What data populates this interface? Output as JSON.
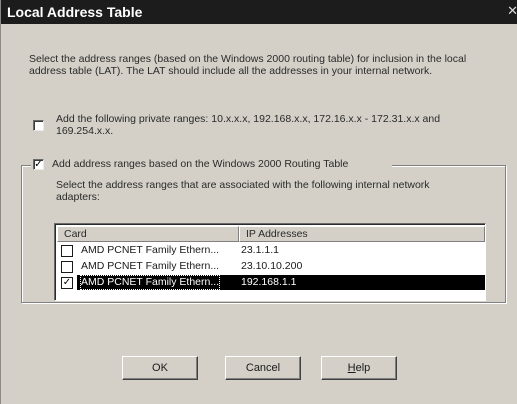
{
  "window": {
    "title": "Local Address Table",
    "close_glyph": "✕"
  },
  "intro": {
    "text": "Select the address ranges (based on the Windows 2000 routing table) for inclusion in the local address table (LAT). The LAT should include all the addresses in your internal network."
  },
  "private_ranges": {
    "checked": false,
    "label": "Add the following private ranges: 10.x.x.x, 192.168.x.x, 172.16.x.x - 172.31.x.x and 169.254.x.x."
  },
  "routing_group": {
    "checked": true,
    "check_glyph": "✓",
    "label": "Add address ranges based on the Windows 2000 Routing Table",
    "instructions": "Select the address ranges that are associated with the following internal network adapters:"
  },
  "adapter_list": {
    "columns": [
      "Card",
      "IP Addresses"
    ],
    "rows": [
      {
        "checked": false,
        "check_glyph": "",
        "card": "AMD PCNET Family Ethern...",
        "ip": "23.1.1.1",
        "selected": false
      },
      {
        "checked": false,
        "check_glyph": "",
        "card": "AMD PCNET Family Ethern...",
        "ip": "23.10.10.200",
        "selected": false
      },
      {
        "checked": true,
        "check_glyph": "✓",
        "card": "AMD PCNET Family Ethern...",
        "ip": "192.168.1.1",
        "selected": true
      }
    ]
  },
  "buttons": {
    "ok": "OK",
    "cancel": "Cancel",
    "help_mnemonic": "H",
    "help_rest": "elp"
  },
  "colors": {
    "titlebar": "#1c1c1c",
    "dialog_face": "#d4d0c8",
    "selection": "#000000"
  },
  "icons": {
    "close": "close-icon",
    "checkbox": "checkbox-icon"
  }
}
